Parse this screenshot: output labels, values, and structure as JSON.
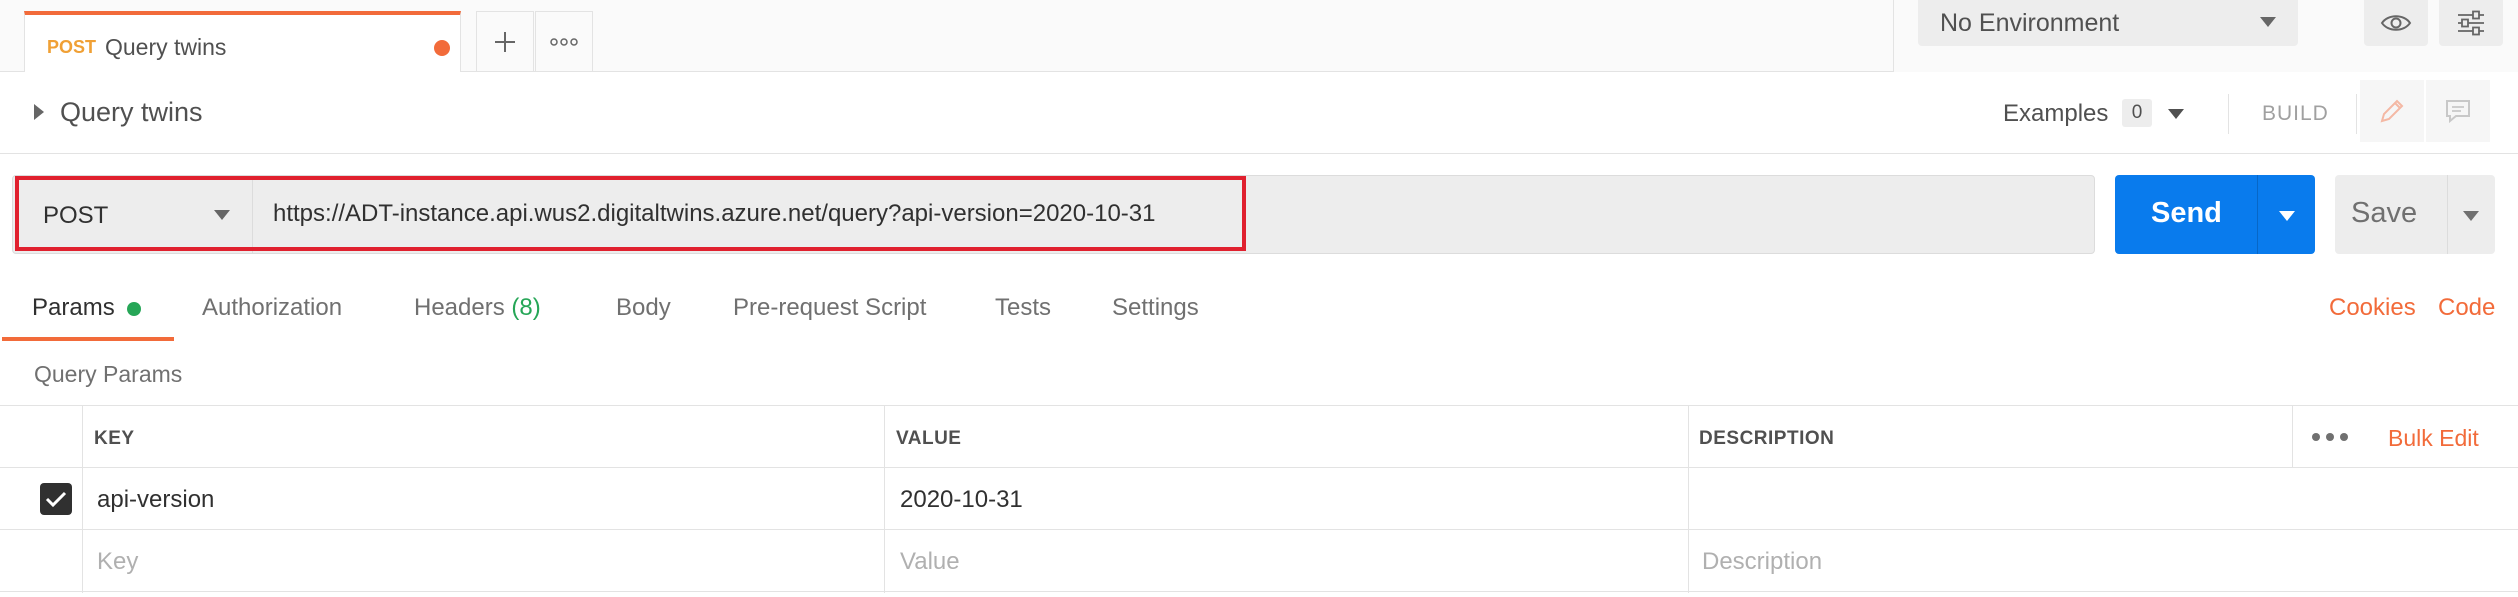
{
  "request_tab": {
    "method": "POST",
    "name": "Query twins"
  },
  "tab_controls": {
    "add_icon": "plus-icon",
    "more_icon": "ellipsis-icon"
  },
  "environment": {
    "selected": "No Environment",
    "icons": [
      "eye-icon",
      "sliders-icon"
    ]
  },
  "title_bar": {
    "title": "Query twins",
    "examples_label": "Examples",
    "examples_count": "0",
    "build_label": "BUILD",
    "icons": [
      "pencil-icon",
      "comment-icon"
    ]
  },
  "url_bar": {
    "method": "POST",
    "url": "https://ADT-instance.api.wus2.digitaltwins.azure.net/query?api-version=2020-10-31",
    "highlight_color": "#e0202e"
  },
  "actions": {
    "send_label": "Send",
    "save_label": "Save",
    "send_color": "#097bed"
  },
  "request_tabs": [
    {
      "label": "Params",
      "active": true
    },
    {
      "label": "Authorization"
    },
    {
      "label": "Headers",
      "count": "(8)"
    },
    {
      "label": "Body"
    },
    {
      "label": "Pre-request Script"
    },
    {
      "label": "Tests"
    },
    {
      "label": "Settings"
    }
  ],
  "right_links": {
    "cookies": "Cookies",
    "code": "Code"
  },
  "query_params": {
    "section_label": "Query Params",
    "headers": {
      "key": "KEY",
      "value": "VALUE",
      "description": "DESCRIPTION"
    },
    "bulk_edit": "Bulk Edit",
    "rows": [
      {
        "checked": true,
        "key": "api-version",
        "value": "2020-10-31",
        "description": ""
      }
    ],
    "placeholders": {
      "key": "Key",
      "value": "Value",
      "description": "Description"
    }
  },
  "accent_color": "#f26b3a"
}
